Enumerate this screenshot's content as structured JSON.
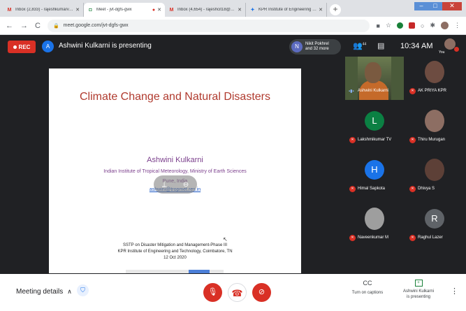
{
  "browser": {
    "tabs": [
      {
        "title": "Inbox (2,833) - rajeshkumarv@k",
        "favicon_color": "#d93025"
      },
      {
        "title": "Meet - jvt-dgfs-gwx",
        "favicon_color": "#188038",
        "active": true
      },
      {
        "title": "Inbox (4,654) - rajeshcit18@gma",
        "favicon_color": "#d93025"
      },
      {
        "title": "KPR Institute of Engineering and",
        "favicon_color": "#1a73e8"
      }
    ],
    "new_tab_label": "+",
    "url": "meet.google.com/jvt-dgfs-gwx"
  },
  "meet": {
    "rec_label": "REC",
    "presenter_initial": "A",
    "presenting_text": "Ashwini Kulkarni is presenting",
    "participants_pill": {
      "initial": "N",
      "line1": "Nikit Pokhrel",
      "line2": "and 32 more"
    },
    "people_count": "44",
    "time": "10:34 AM",
    "self_label": "You",
    "slide": {
      "title": "Climate Change and Natural Disasters",
      "author": "Ashwini Kulkarni",
      "institute": "Indian Institute of Tropical Meteorology, Ministry of Earth Sciences",
      "country": "Pune, India",
      "email": "ashwini@tropmet.res.in",
      "event_line1": "SSTP on Disaster Mitigation and Management-Phase III",
      "event_line2": "KPR Institute of Engineering and Technology, Coimbatore, TN",
      "event_line3": "12 Oct 2020"
    },
    "tiles": [
      {
        "name": "Ashwini Kulkarni",
        "type": "video",
        "speaking": true
      },
      {
        "name": "AK PRIYA KPR",
        "type": "photo",
        "color": "#6d4c41"
      },
      {
        "name": "Lakshmikumar TV",
        "type": "initial",
        "initial": "L",
        "color": "#0b8043"
      },
      {
        "name": "Thiru Murugan",
        "type": "photo",
        "color": "#8d6e63"
      },
      {
        "name": "Himal Sapkota",
        "type": "initial",
        "initial": "H",
        "color": "#1a73e8"
      },
      {
        "name": "Dhivya S",
        "type": "photo",
        "color": "#5d4037"
      },
      {
        "name": "Naveenkumar M",
        "type": "photo",
        "color": "#9e9e9e"
      },
      {
        "name": "Raghul Lazer",
        "type": "initial",
        "initial": "R",
        "color": "#5f6368"
      }
    ]
  },
  "controls": {
    "meeting_details": "Meeting details",
    "captions": "Turn on captions",
    "captions_icon": "CC",
    "presenting_line1": "Ashwini Kulkarni",
    "presenting_line2": "is presenting"
  }
}
